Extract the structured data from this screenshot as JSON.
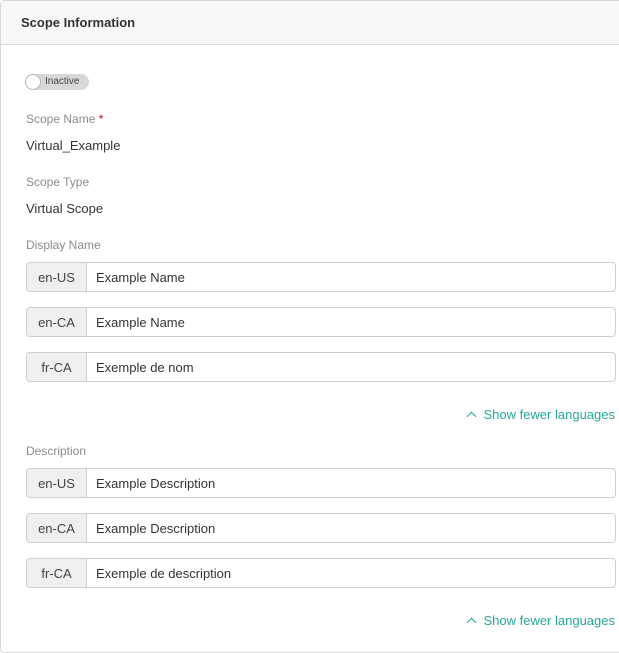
{
  "header": {
    "title": "Scope Information"
  },
  "status_toggle": {
    "label": "Inactive"
  },
  "scope_name": {
    "label": "Scope Name",
    "required_mark": "*",
    "value": "Virtual_Example"
  },
  "scope_type": {
    "label": "Scope Type",
    "value": "Virtual Scope"
  },
  "display_name": {
    "label": "Display Name",
    "rows": [
      {
        "lang": "en-US",
        "value": "Example Name"
      },
      {
        "lang": "en-CA",
        "value": "Example Name"
      },
      {
        "lang": "fr-CA",
        "value": "Exemple de nom"
      }
    ],
    "toggle_link": "Show fewer languages"
  },
  "description": {
    "label": "Description",
    "rows": [
      {
        "lang": "en-US",
        "value": "Example Description"
      },
      {
        "lang": "en-CA",
        "value": "Example Description"
      },
      {
        "lang": "fr-CA",
        "value": "Exemple de description"
      }
    ],
    "toggle_link": "Show fewer languages"
  },
  "colors": {
    "link": "#26a69a",
    "required": "#d0021b",
    "header_bg": "#f7f7f7"
  }
}
